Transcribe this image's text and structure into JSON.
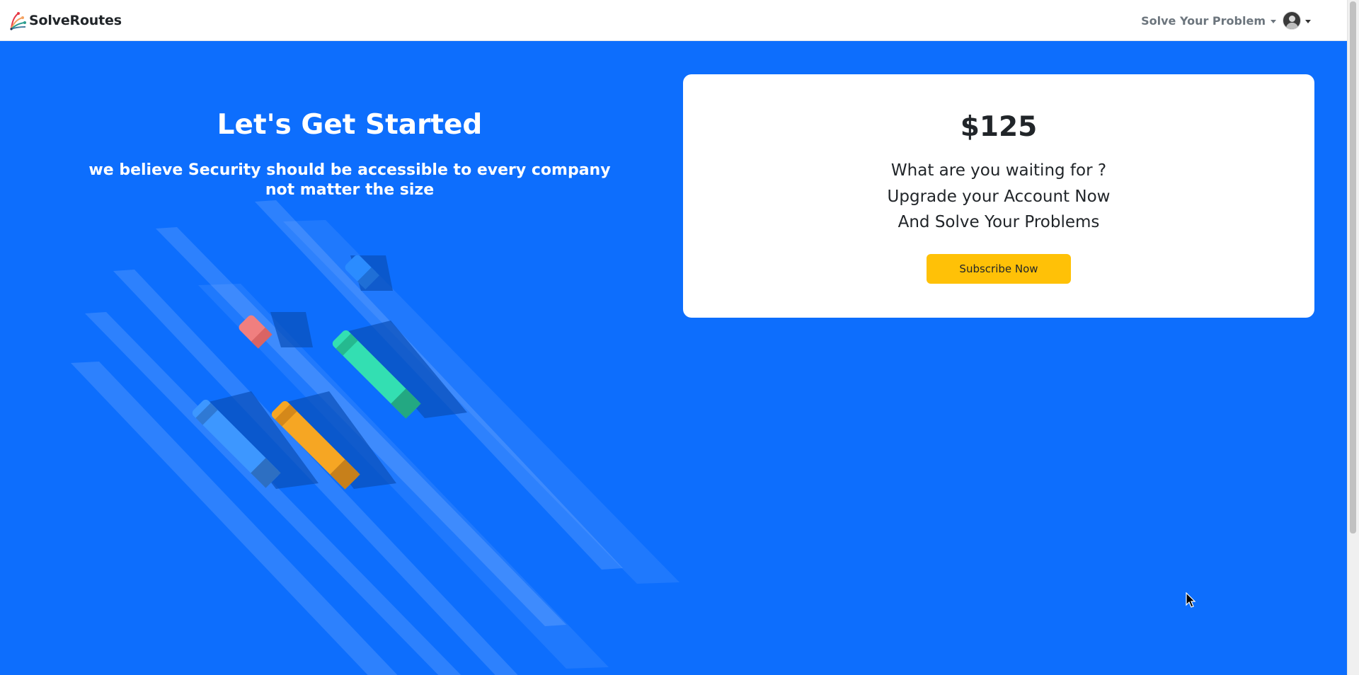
{
  "navbar": {
    "brand": "SolveRoutes",
    "logo_icon": "solveroutes-logo-icon",
    "menu_label": "Solve Your Problem",
    "avatar_icon": "user-avatar-icon"
  },
  "hero": {
    "title": "Let's Get Started",
    "subtitle": "we believe Security should be accessible to every company not matter the size",
    "illustration_icon": "pens-illustration"
  },
  "pricing_card": {
    "price": "$125",
    "lines": [
      "What are you waiting for ?",
      "Upgrade your Account Now",
      "And Solve Your Problems"
    ],
    "button_label": "Subscribe Now"
  },
  "colors": {
    "primary_blue": "#0d6efd",
    "button_yellow": "#ffc107",
    "card_background": "#ffffff",
    "text_dark": "#212529",
    "nav_text": "#6c757d"
  }
}
